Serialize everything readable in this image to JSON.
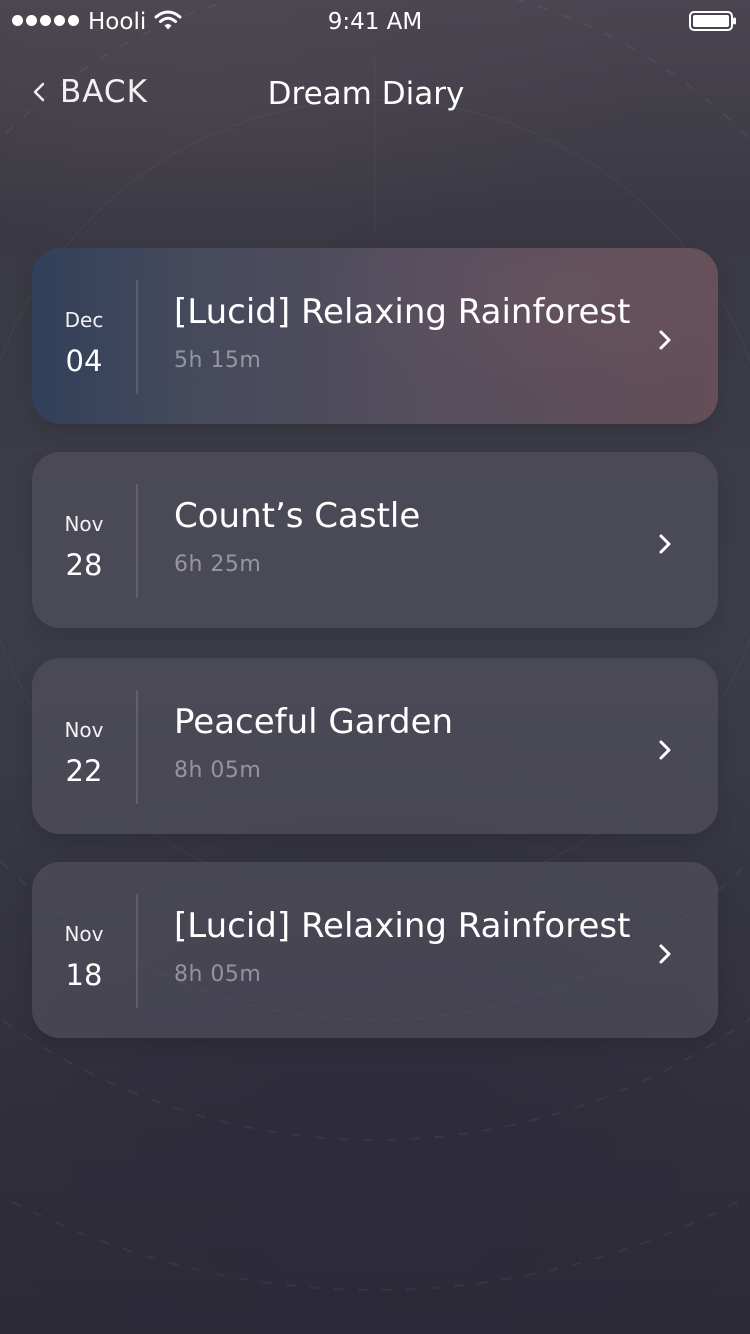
{
  "status_bar": {
    "carrier": "Hooli",
    "time": "9:41 AM"
  },
  "nav": {
    "back_label": "BACK",
    "title": "Dream Diary"
  },
  "entries": [
    {
      "month": "Dec",
      "day": "04",
      "title": "[Lucid] Relaxing Rainforest",
      "duration": "5h 15m",
      "featured": true
    },
    {
      "month": "Nov",
      "day": "28",
      "title": "Count’s Castle",
      "duration": "6h 25m",
      "featured": false
    },
    {
      "month": "Nov",
      "day": "22",
      "title": "Peaceful Garden",
      "duration": "8h 05m",
      "featured": false
    },
    {
      "month": "Nov",
      "day": "18",
      "title": "[Lucid] Relaxing Rainforest",
      "duration": "8h 05m",
      "featured": false
    }
  ],
  "icons": {
    "signal": "signal-dots-icon",
    "wifi": "wifi-icon",
    "battery": "battery-icon",
    "back": "chevron-left-icon",
    "row_arrow": "chevron-right-icon"
  },
  "colors": {
    "text": "#ffffff",
    "secondary_text": "#8e8d97",
    "card_background": "#4f4e5a",
    "background_top": "#4a4550",
    "background_bottom": "#2b2a34"
  }
}
